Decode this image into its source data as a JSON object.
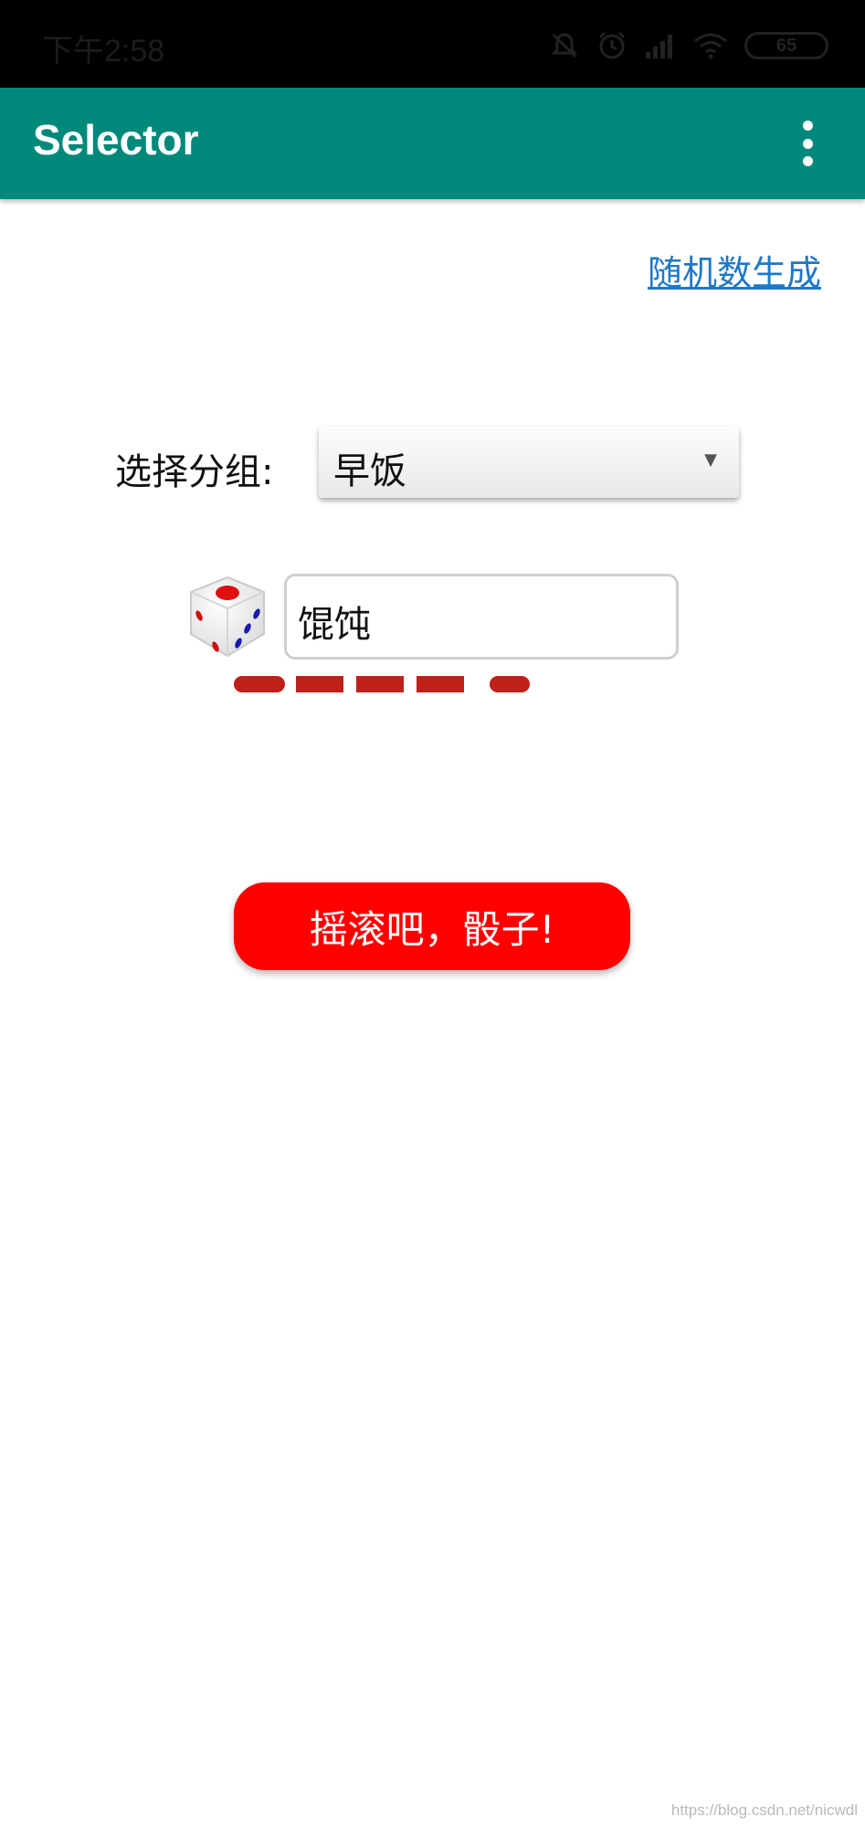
{
  "status_bar": {
    "time": "下午2:58",
    "battery": "65",
    "icons": [
      "mute-alarm-icon",
      "alarm-clock-icon",
      "signal-icon",
      "wifi-icon",
      "battery-icon"
    ]
  },
  "app_bar": {
    "title": "Selector",
    "menu_icon": "more-vert-icon",
    "background_color": "#00897b"
  },
  "main": {
    "random_link": "随机数生成",
    "group_label": "选择分组:",
    "group_select": {
      "selected": "早饭"
    },
    "dice_icon": "dice-icon",
    "result_value": "馄饨",
    "roll_button": "摇滚吧，骰子!",
    "roll_button_color": "#ff0000",
    "accent_color": "#c0201a"
  },
  "watermark": "https://blog.csdn.net/nicwdl"
}
